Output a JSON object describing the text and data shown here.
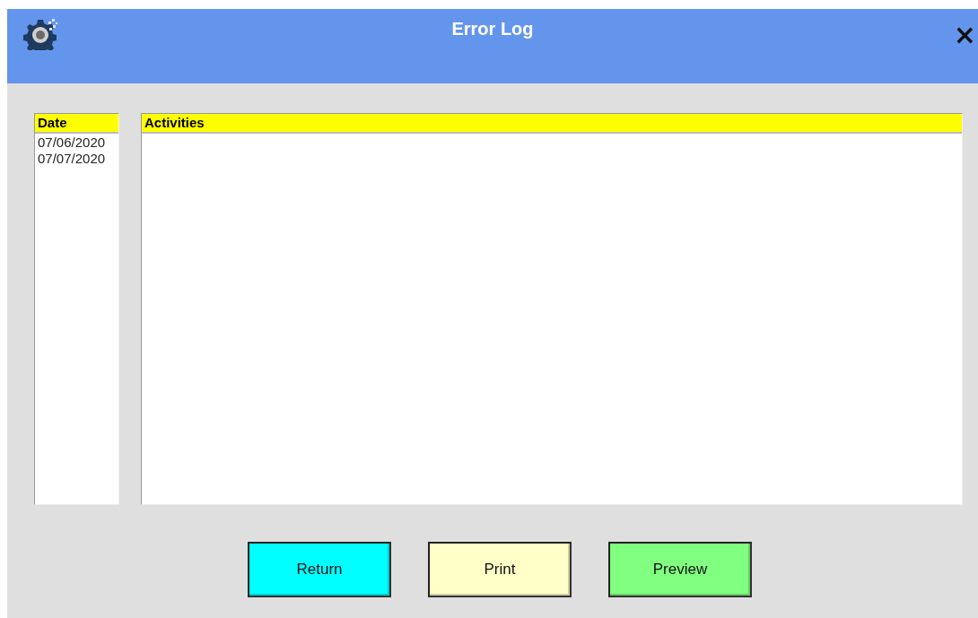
{
  "window": {
    "title": "Error Log",
    "close": "×"
  },
  "date_list": {
    "header": "Date",
    "items": [
      "07/06/2020",
      "07/07/2020"
    ]
  },
  "activities": {
    "header": "Activities"
  },
  "buttons": [
    {
      "label": "Return",
      "color": "#00ffff"
    },
    {
      "label": "Print",
      "color": "#ffffc8"
    },
    {
      "label": "Preview",
      "color": "#80ff80"
    }
  ]
}
